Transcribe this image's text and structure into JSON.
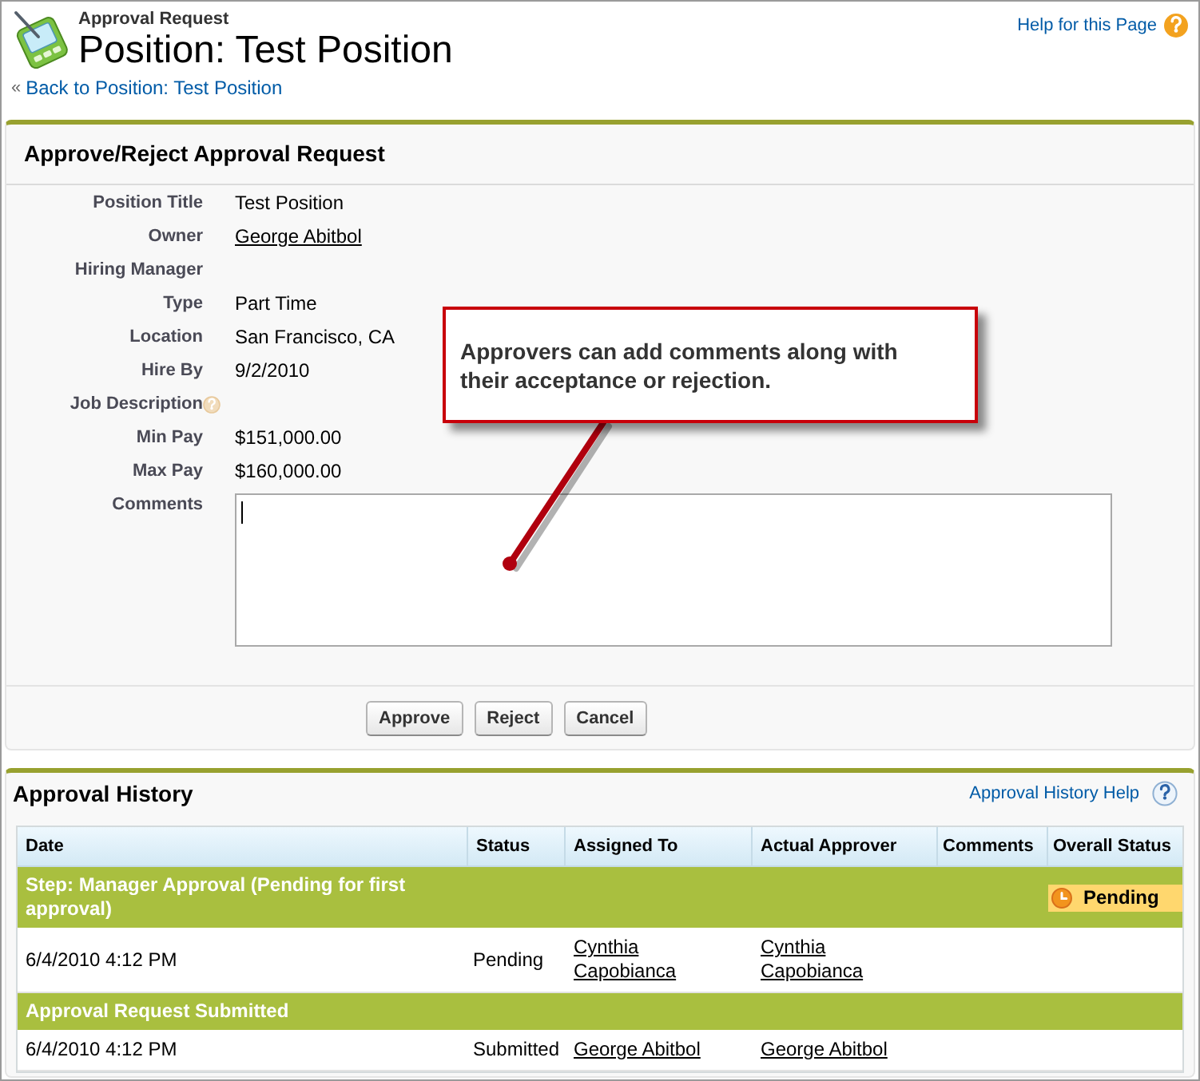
{
  "header": {
    "breadcrumb": "Approval Request",
    "title": "Position: Test Position",
    "back_marker": "«",
    "back_link": "Back to Position: Test Position",
    "help_link": "Help for this Page"
  },
  "approval_form": {
    "title": "Approve/Reject Approval Request",
    "fields": [
      {
        "label": "Position Title",
        "kind": "text",
        "value": "Test Position",
        "help_icon": false
      },
      {
        "label": "Owner",
        "kind": "link",
        "value": "George Abitbol",
        "help_icon": false
      },
      {
        "label": "Hiring Manager",
        "kind": "text",
        "help_icon": false
      },
      {
        "label": "Type",
        "kind": "text",
        "value": "Part Time",
        "help_icon": false
      },
      {
        "label": "Location",
        "kind": "text",
        "value": "San Francisco, CA",
        "help_icon": false
      },
      {
        "label": "Hire By",
        "kind": "text",
        "value": "9/2/2010",
        "help_icon": false
      },
      {
        "label": "Job Description",
        "kind": "text",
        "help_icon": true
      },
      {
        "label": "Min Pay",
        "kind": "text",
        "value": "$151,000.00",
        "help_icon": false
      },
      {
        "label": "Max Pay",
        "kind": "text",
        "value": "$160,000.00",
        "help_icon": false
      },
      {
        "label": "Comments",
        "kind": "textarea",
        "focused": true,
        "help_icon": false
      }
    ],
    "buttons": [
      "Approve",
      "Reject",
      "Cancel"
    ]
  },
  "callout": {
    "text": "Approvers can add comments along with their acceptance or rejection."
  },
  "approval_history": {
    "title": "Approval History",
    "help_link": "Approval History Help",
    "columns": [
      "Date",
      "Status",
      "Assigned To",
      "Actual Approver",
      "Comments",
      "Overall Status"
    ],
    "rows": [
      {
        "kind": "step",
        "title": "Step: Manager Approval (Pending for first approval)",
        "overall_status": "Pending"
      },
      {
        "kind": "entry",
        "date": "6/4/2010 4:12 PM",
        "status": "Pending",
        "assigned_to": "Cynthia Capobianca",
        "actual_approver": "Cynthia Capobianca"
      },
      {
        "kind": "step",
        "title": "Approval Request Submitted"
      },
      {
        "kind": "entry",
        "date": "6/4/2010 4:12 PM",
        "status": "Submitted",
        "assigned_to": "George Abitbol",
        "actual_approver": "George Abitbol"
      }
    ]
  }
}
